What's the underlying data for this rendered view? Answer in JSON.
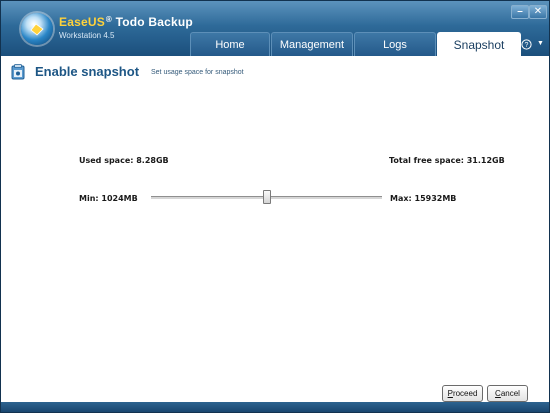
{
  "app": {
    "brand_part1": "EaseUS",
    "brand_sup": "®",
    "brand_part2": "Todo Backup",
    "subtitle": "Workstation 4.5",
    "icon": "easeus-logo-icon"
  },
  "window_controls": {
    "minimize": "–",
    "close": "✕"
  },
  "tabs": [
    {
      "label": "Home",
      "active": false
    },
    {
      "label": "Management",
      "active": false
    },
    {
      "label": "Logs",
      "active": false
    },
    {
      "label": "Snapshot",
      "active": true
    }
  ],
  "help": {
    "glyph": "?",
    "caret": "▼"
  },
  "page": {
    "icon": "snapshot-icon",
    "title": "Enable snapshot",
    "subtitle": "Set usage space for snapshot"
  },
  "space": {
    "used_label": "Used space: 8.28GB",
    "free_label": "Total free space: 31.12GB",
    "min_label": "Min: 1024MB",
    "max_label": "Max: 15932MB",
    "slider_fraction": 0.5
  },
  "buttons": {
    "proceed": "Proceed",
    "cancel": "Cancel"
  },
  "colors": {
    "title_bar": "#2e6a99",
    "accent": "#1d5685",
    "brand_highlight": "#ffd23b"
  }
}
